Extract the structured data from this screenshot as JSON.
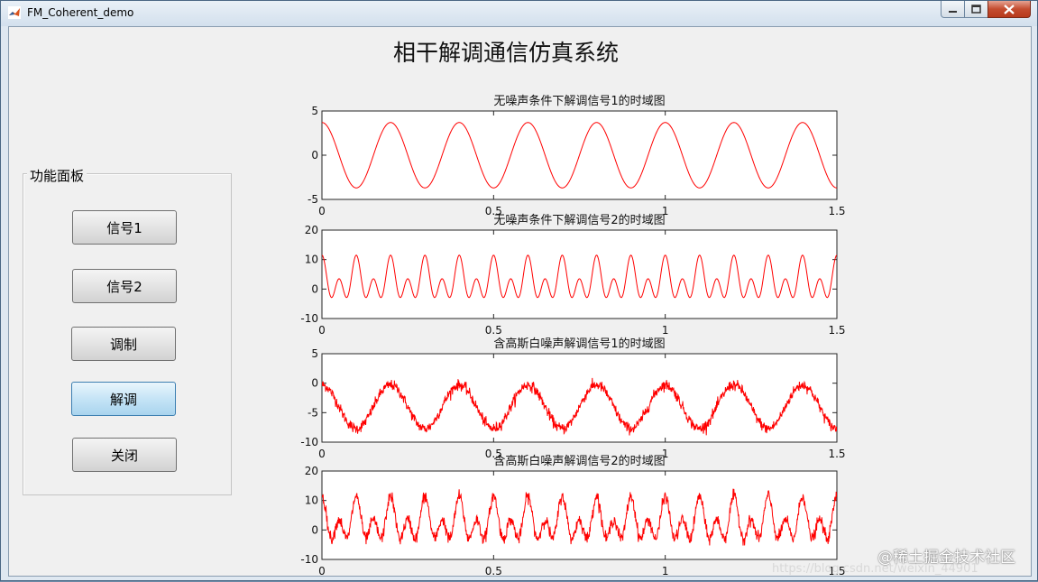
{
  "window": {
    "title": "FM_Coherent_demo",
    "accent_color": "#c0392b"
  },
  "main_title": "相干解调通信仿真系统",
  "panel": {
    "title": "功能面板",
    "buttons": [
      {
        "label": "信号1",
        "active": false
      },
      {
        "label": "信号2",
        "active": false
      },
      {
        "label": "调制",
        "active": false
      },
      {
        "label": "解调",
        "active": true
      },
      {
        "label": "关闭",
        "active": false
      }
    ]
  },
  "chart_data": [
    {
      "type": "line",
      "title": "无噪声条件下解调信号1的时域图",
      "xlim": [
        0,
        1.5
      ],
      "ylim": [
        -5,
        5
      ],
      "xticks": [
        "0",
        "0.5",
        "1",
        "1.5"
      ],
      "yticks": [
        "5",
        "0",
        "-5"
      ],
      "grid": false,
      "color": "#ff0000",
      "series": [
        {
          "function": "3.7*cos(2*pi*5*t)",
          "frequency_hz": 5,
          "amplitude": 3.7,
          "offset": 0,
          "noise": 0
        }
      ]
    },
    {
      "type": "line",
      "title": "无噪声条件下解调信号2的时域图",
      "xlim": [
        0,
        1.5
      ],
      "ylim": [
        -10,
        20
      ],
      "xticks": [
        "0",
        "0.5",
        "1",
        "1.5"
      ],
      "yticks": [
        "20",
        "10",
        "0",
        "-10"
      ],
      "grid": false,
      "color": "#ff0000",
      "series": [
        {
          "function": "2.5 + 4*cos(2*pi*10*t) + 5*cos(2*pi*20*t)",
          "offset": 2.5,
          "components": [
            {
              "frequency_hz": 10,
              "amplitude": 4
            },
            {
              "frequency_hz": 20,
              "amplitude": 5
            }
          ],
          "noise": 0
        }
      ]
    },
    {
      "type": "line",
      "title": "含高斯白噪声解调信号1的时域图",
      "xlim": [
        0,
        1.5
      ],
      "ylim": [
        -10,
        5
      ],
      "xticks": [
        "0",
        "0.5",
        "1",
        "1.5"
      ],
      "yticks": [
        "5",
        "0",
        "-5",
        "-10"
      ],
      "grid": false,
      "color": "#ff0000",
      "series": [
        {
          "function": "-4 + 3.7*cos(2*pi*5*t) + noise",
          "frequency_hz": 5,
          "amplitude": 3.7,
          "offset": -4,
          "noise": 0.45
        }
      ]
    },
    {
      "type": "line",
      "title": "含高斯白噪声解调信号2的时域图",
      "xlim": [
        0,
        1.5
      ],
      "ylim": [
        -10,
        20
      ],
      "xticks": [
        "0",
        "0.5",
        "1",
        "1.5"
      ],
      "yticks": [
        "20",
        "10",
        "0",
        "-10"
      ],
      "grid": false,
      "color": "#ff0000",
      "series": [
        {
          "function": "2.5 + 4*cos(2*pi*10*t) + 5*cos(2*pi*20*t) + noise",
          "offset": 2.5,
          "components": [
            {
              "frequency_hz": 10,
              "amplitude": 4
            },
            {
              "frequency_hz": 20,
              "amplitude": 5
            }
          ],
          "noise": 1.0
        }
      ]
    }
  ],
  "watermark": {
    "text": "@稀土掘金技术社区",
    "url": "https://blog.csdn.net/weixin_44901"
  }
}
